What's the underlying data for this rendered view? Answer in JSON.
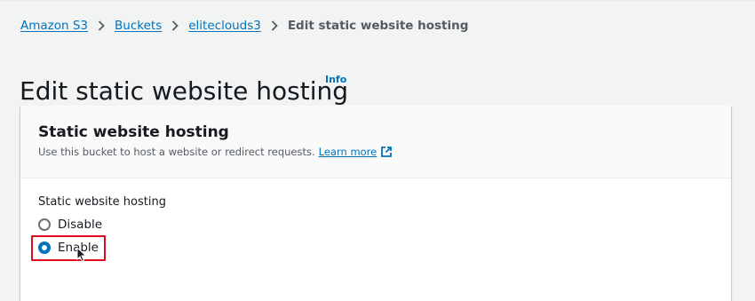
{
  "breadcrumb": {
    "items": [
      "Amazon S3",
      "Buckets",
      "eliteclouds3"
    ],
    "current": "Edit static website hosting"
  },
  "page": {
    "title": "Edit static website hosting",
    "info_label": "Info"
  },
  "panel": {
    "title": "Static website hosting",
    "description": "Use this bucket to host a website or redirect requests.",
    "learn_more": "Learn more",
    "field_label": "Static website hosting",
    "options": [
      {
        "label": "Disable",
        "selected": false
      },
      {
        "label": "Enable",
        "selected": true
      }
    ]
  },
  "icons": {
    "breadcrumb_separator": "chevron-right-icon",
    "external_link": "external-link-icon",
    "cursor": "mouse-pointer-icon"
  },
  "colors": {
    "link": "#0073bb",
    "highlight": "#e0081d",
    "background": "#f2f3f3"
  }
}
